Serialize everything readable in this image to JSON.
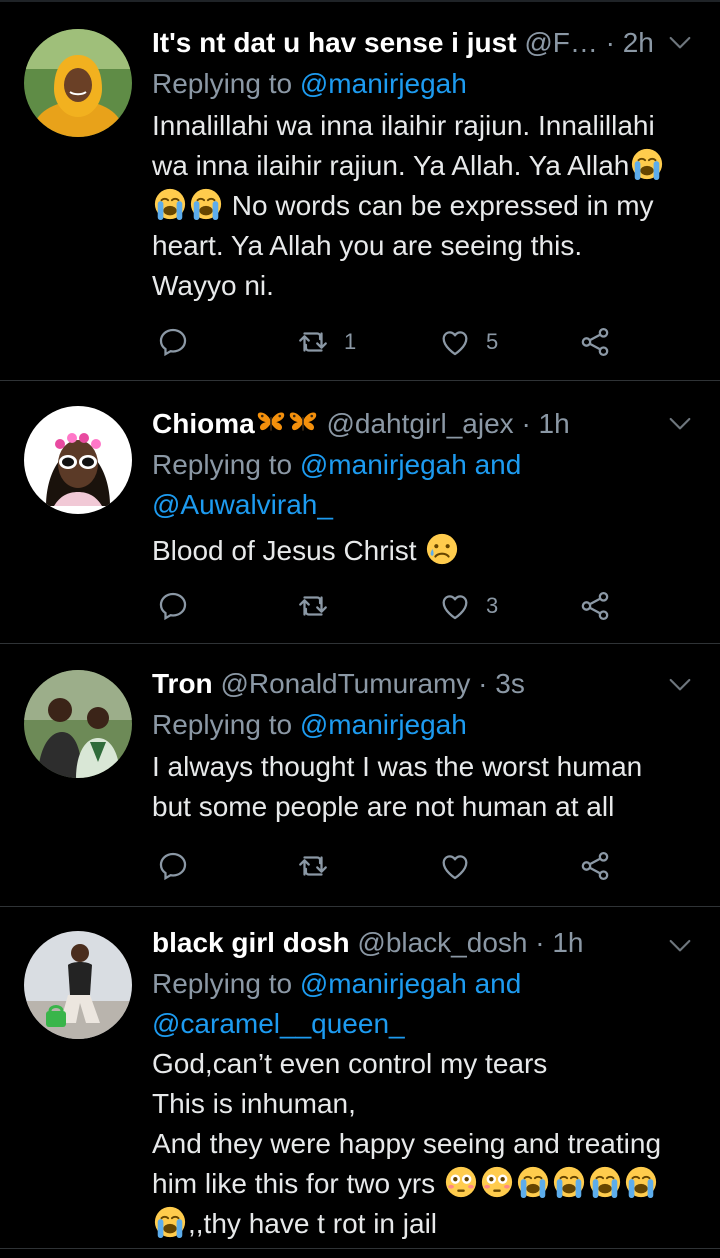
{
  "tweets": [
    {
      "name": "It's nt dat u hav sense i just",
      "handle": "@F…",
      "time": "· 2h",
      "replying_prefix": "Replying to ",
      "replying_to": "@manirjegah",
      "replying_line2": "",
      "body_lines": [
        "Innalillahi wa inna ilaihir rajiun. Innalillahi",
        "wa inna ilaihir rajiun. Ya Allah. Ya Allah",
        "No words can be expressed in my",
        "heart. Ya Allah you are seeing this.",
        "Wayyo ni."
      ],
      "retweets": "1",
      "likes": "5"
    },
    {
      "name": "Chioma",
      "handle": "@dahtgirl_ajex",
      "time": "· 1h",
      "replying_prefix": "Replying to ",
      "replying_to": "@manirjegah and",
      "replying_line2": "@Auwalvirah_",
      "body_lines": [
        "Blood of Jesus Christ"
      ],
      "retweets": "",
      "likes": "3"
    },
    {
      "name": "Tron",
      "handle": "@RonaldTumuramy",
      "time": "· 3s",
      "replying_prefix": "Replying to ",
      "replying_to": "@manirjegah",
      "replying_line2": "",
      "body_lines": [
        "I always thought I was the worst human",
        "but some people are not human at all"
      ],
      "retweets": "",
      "likes": ""
    },
    {
      "name": "black girl dosh",
      "handle": "@black_dosh",
      "time": "· 1h",
      "replying_prefix": "Replying to ",
      "replying_to": "@manirjegah and",
      "replying_line2": "@caramel__queen_",
      "body_lines": [
        "God,can’t even control my tears",
        "This is inhuman,",
        "And they were happy seeing and treating",
        "him like this for two yrs",
        ",,thy have t rot in jail"
      ],
      "retweets": "",
      "likes": ""
    }
  ],
  "colors": {
    "background": "#000000",
    "link": "#1d9bf0",
    "muted": "#8b98a5",
    "text": "#e7e9ea"
  },
  "icons": [
    "reply-icon",
    "retweet-icon",
    "like-icon",
    "share-icon",
    "chevron-down-icon",
    "crying-face-emoji",
    "flushed-face-emoji",
    "sad-relieved-face-emoji",
    "butterfly-emoji"
  ]
}
